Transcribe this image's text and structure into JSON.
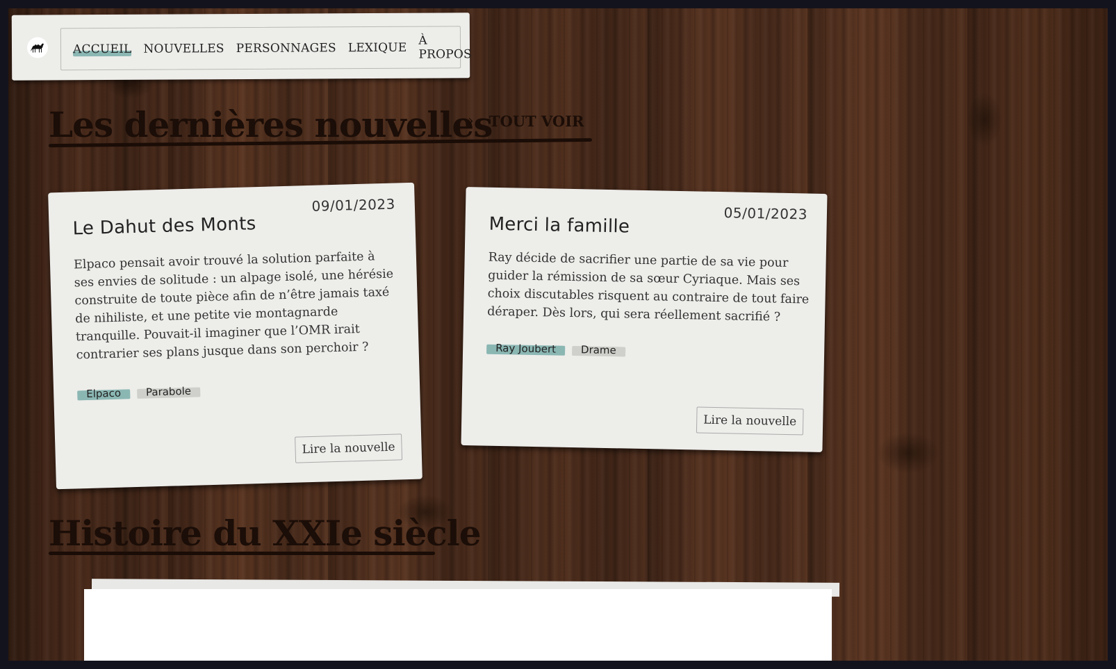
{
  "nav": {
    "logo_icon": "camel-icon",
    "items": [
      {
        "label": "ACCUEIL",
        "active": true
      },
      {
        "label": "NOUVELLES",
        "active": false
      },
      {
        "label": "PERSONNAGES",
        "active": false
      },
      {
        "label": "LEXIQUE",
        "active": false
      },
      {
        "label": "À PROPOS",
        "active": false
      }
    ]
  },
  "latest": {
    "title": "Les dernières nouvelles",
    "see_all_label": "TOUT VOIR",
    "see_all_icon": "chevron-right-icon"
  },
  "stories": [
    {
      "date": "09/01/2023",
      "title": "Le Dahut des Monts",
      "summary": "Elpaco pensait avoir trouvé la solution parfaite à ses envies de solitude : un alpage isolé, une hérésie construite de toute pièce afin de n’être jamais taxé de nihiliste, et une petite vie montagnarde tranquille. Pouvait-il imaginer que l’OMR irait contrarier ses plans jusque dans son perchoir ?",
      "tags": [
        {
          "label": "Elpaco",
          "color": "#8bb7b3"
        },
        {
          "label": "Parabole",
          "color": "#cfcfcb"
        }
      ],
      "read_label": "Lire la nouvelle"
    },
    {
      "date": "05/01/2023",
      "title": "Merci la famille",
      "summary": "Ray décide de sacrifier une partie de sa vie pour guider la rémission de sa sœur Cyriaque. Mais ses choix discutables risquent au contraire de tout faire déraper. Dès lors, qui sera réellement sacrifié ?",
      "tags": [
        {
          "label": "Ray Joubert",
          "color": "#8bb7b3"
        },
        {
          "label": "Drame",
          "color": "#cfcfcb"
        }
      ],
      "read_label": "Lire la nouvelle"
    }
  ],
  "history": {
    "title": "Histoire du XXIe siècle"
  },
  "colors": {
    "accent_teal": "#8bb7b3",
    "tag_grey": "#cfcfcb",
    "paper": "#ededea",
    "heading": "#1b0d07"
  }
}
